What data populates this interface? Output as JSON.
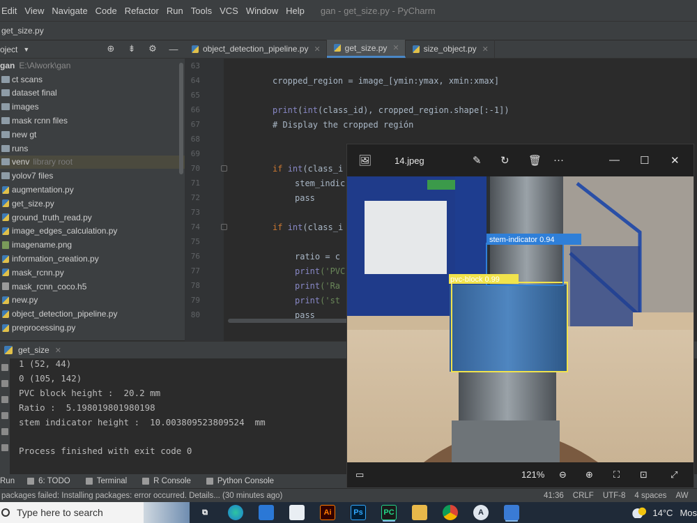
{
  "menubar": {
    "items": [
      "Edit",
      "View",
      "Navigate",
      "Code",
      "Refactor",
      "Run",
      "Tools",
      "VCS",
      "Window",
      "Help"
    ],
    "window_title": "gan - get_size.py - PyCharm"
  },
  "breadcrumb": {
    "file": "get_size.py"
  },
  "project_panel": {
    "title": "oject",
    "root": {
      "name": "gan",
      "path": "E:\\Alwork\\gan"
    },
    "items": [
      {
        "name": "ct scans",
        "type": "folder"
      },
      {
        "name": "dataset final",
        "type": "folder"
      },
      {
        "name": "images",
        "type": "folder"
      },
      {
        "name": "mask rcnn files",
        "type": "folder"
      },
      {
        "name": "new gt",
        "type": "folder"
      },
      {
        "name": "runs",
        "type": "folder"
      },
      {
        "name": "venv",
        "type": "folder",
        "note": "library root"
      },
      {
        "name": "yolov7 files",
        "type": "folder"
      },
      {
        "name": "augmentation.py",
        "type": "py"
      },
      {
        "name": "get_size.py",
        "type": "py"
      },
      {
        "name": "ground_truth_read.py",
        "type": "py"
      },
      {
        "name": "image_edges_calculation.py",
        "type": "py"
      },
      {
        "name": "imagename.png",
        "type": "png"
      },
      {
        "name": "information_creation.py",
        "type": "py"
      },
      {
        "name": "mask_rcnn.py",
        "type": "py"
      },
      {
        "name": "mask_rcnn_coco.h5",
        "type": "h5"
      },
      {
        "name": "new.py",
        "type": "py"
      },
      {
        "name": "object_detection_pipeline.py",
        "type": "py"
      },
      {
        "name": "preprocessing.py",
        "type": "py"
      }
    ]
  },
  "editor_tabs": [
    {
      "label": "object_detection_pipeline.py",
      "active": false
    },
    {
      "label": "get_size.py",
      "active": true
    },
    {
      "label": "size_object.py",
      "active": false
    }
  ],
  "editor": {
    "line_numbers": [
      "63",
      "64",
      "65",
      "66",
      "67",
      "68",
      "69",
      "70",
      "71",
      "72",
      "73",
      "74",
      "75",
      "76",
      "77",
      "78",
      "79",
      "80"
    ],
    "code": {
      "l64_a": "cropped_region = image_[ymin:ymax, xmin:xmax]",
      "l66_print": "print",
      "l66_a": "(",
      "l66_int": "int",
      "l66_b": "(class_id), cropped_region.shape[:-1])",
      "l67": "# Display the cropped región",
      "l70_if": "if ",
      "l70_int": "int",
      "l70_b": "(class_i",
      "l71": "stem_indic",
      "l72": "pass",
      "l74_if": "if ",
      "l74_int": "int",
      "l74_b": "(class_i",
      "l76": "ratio = c",
      "l77_print": "print",
      "l77_b": "('PVC",
      "l78_print": "print",
      "l78_b": "('Ra",
      "l79_print": "print",
      "l79_b": "('st",
      "l80": "pass"
    }
  },
  "run_panel": {
    "tab_label": "get_size",
    "output": [
      "1 (52, 44)",
      "0 (105, 142)",
      "PVC block height :  20.2 mm",
      "Ratio :  5.198019801980198",
      "stem indicator height :  10.003809523809524  mm",
      "",
      "Process finished with exit code 0"
    ]
  },
  "tool_tabs": [
    "Run",
    "6: TODO",
    "Terminal",
    "R Console",
    "Python Console"
  ],
  "statusbar": {
    "message": "packages failed: Installing packages: error occurred. Details... (30 minutes ago)",
    "position": "41:36",
    "line_sep": "CRLF",
    "encoding": "UTF-8",
    "indent": "4 spaces",
    "extra": "AW"
  },
  "taskbar": {
    "search_placeholder": "Type here to search",
    "temperature": "14°C",
    "weather_text": "Mos"
  },
  "viewer": {
    "filename": "14.jpeg",
    "zoom": "121%",
    "detections": [
      {
        "label": "stem-indicator  0.94",
        "color": "#2f7fd8"
      },
      {
        "label": "pvc-block  0.99",
        "color": "#f1e34c"
      }
    ]
  },
  "colors": {
    "accent_tab": "#4a88c7",
    "box_stem": "#2f7fd8",
    "box_pvc": "#f1e34c"
  }
}
